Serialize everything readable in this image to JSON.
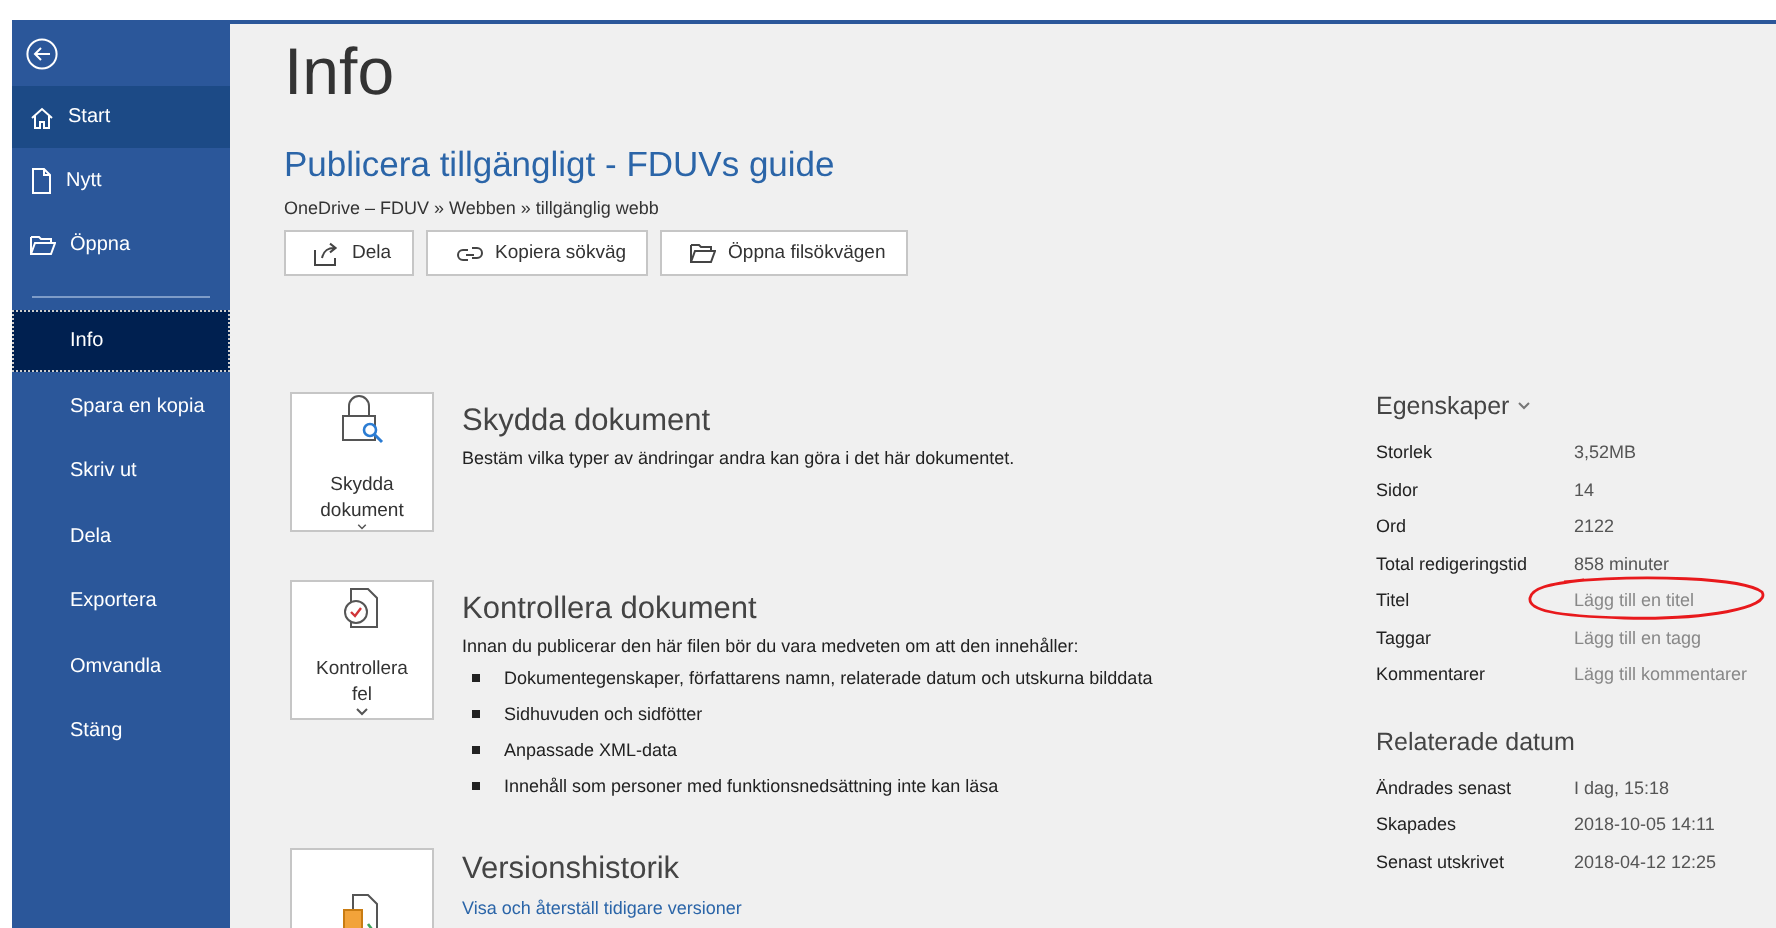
{
  "sidebar": {
    "items": [
      {
        "label": "Start",
        "kind": "main",
        "hovered": true,
        "selected": false
      },
      {
        "label": "Nytt",
        "kind": "main",
        "hovered": false,
        "selected": false
      },
      {
        "label": "Öppna",
        "kind": "main",
        "hovered": false,
        "selected": false
      },
      {
        "kind": "divider"
      },
      {
        "label": "Info",
        "selected": true,
        "hovered": false
      },
      {
        "label": "Spara en kopia",
        "selected": false,
        "hovered": false
      },
      {
        "label": "Skriv ut",
        "selected": false,
        "hovered": false
      },
      {
        "label": "Dela",
        "selected": false,
        "hovered": false
      },
      {
        "label": "Exportera",
        "selected": false,
        "hovered": false
      },
      {
        "label": "Omvandla",
        "selected": false,
        "hovered": false
      },
      {
        "label": "Stäng",
        "selected": false,
        "hovered": false
      }
    ]
  },
  "page_title": "Info",
  "document": {
    "title": "Publicera tillgängligt - FDUVs guide",
    "path": "OneDrive – FDUV » Webben » tillgänglig webb",
    "actions": [
      {
        "label": "Dela"
      },
      {
        "label": "Kopiera sökväg"
      },
      {
        "label": "Öppna filsökvägen"
      }
    ]
  },
  "sections": [
    {
      "button": [
        "Skydda",
        "dokument"
      ],
      "heading": "Skydda dokument",
      "text": "Bestäm vilka typer av ändringar andra kan göra i det här dokumentet."
    },
    {
      "button": [
        "Kontrollera",
        "fel"
      ],
      "heading": "Kontrollera dokument",
      "text": "Innan du publicerar den här filen bör du vara medveten om att den innehåller:",
      "bullets": [
        "Dokumentegenskaper, författarens namn, relaterade datum och utskurna bilddata",
        "Sidhuvuden och sidfötter",
        "Anpassade XML-data",
        "Innehåll som personer med funktionsnedsättning inte kan läsa"
      ]
    },
    {
      "heading": "Versionshistorik",
      "link": "Visa och återställ tidigare versioner"
    }
  ],
  "properties": {
    "heading": "Egenskaper",
    "rows": [
      {
        "label": "Storlek",
        "value": "3,52MB"
      },
      {
        "label": "Sidor",
        "value": "14"
      },
      {
        "label": "Ord",
        "value": "2122"
      },
      {
        "label": "Total redigeringstid",
        "value": "858 minuter"
      },
      {
        "label": "Titel",
        "placeholder": "Lägg till en titel",
        "circled": true
      },
      {
        "label": "Taggar",
        "placeholder": "Lägg till en tagg",
        "circled": false
      },
      {
        "label": "Kommentarer",
        "placeholder": "Lägg till kommentarer",
        "circled": false
      }
    ]
  },
  "related_dates": {
    "heading": "Relaterade datum",
    "rows": [
      {
        "label": "Ändrades senast",
        "value": "I dag, 15:18"
      },
      {
        "label": "Skapades",
        "value": "2018-10-05 14:11"
      },
      {
        "label": "Senast utskrivet",
        "value": "2018-04-12 12:25"
      }
    ]
  }
}
